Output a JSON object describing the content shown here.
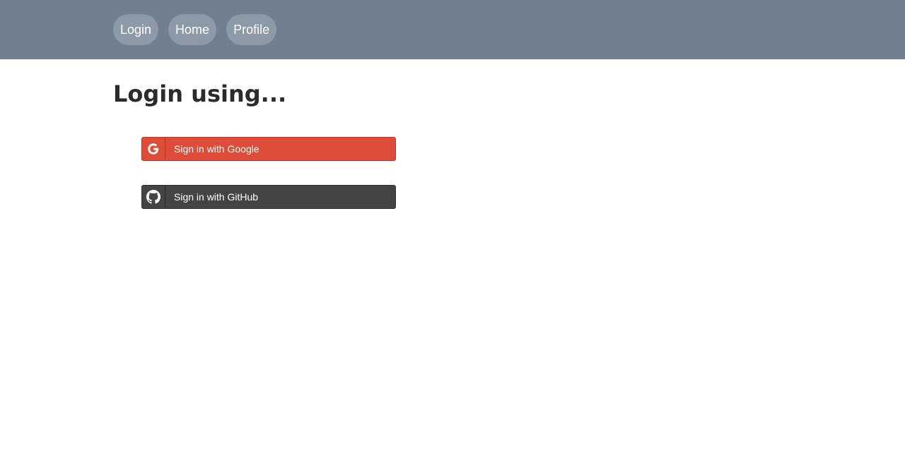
{
  "nav": {
    "items": [
      {
        "label": "Login"
      },
      {
        "label": "Home"
      },
      {
        "label": "Profile"
      }
    ]
  },
  "main": {
    "title": "Login using...",
    "buttons": [
      {
        "label": "Sign in with Google",
        "icon": "google-icon",
        "color": "#dd4b39"
      },
      {
        "label": "Sign in with GitHub",
        "icon": "github-icon",
        "color": "#444444"
      }
    ]
  },
  "colors": {
    "header": "#708090",
    "title": "#2b2b2b"
  }
}
